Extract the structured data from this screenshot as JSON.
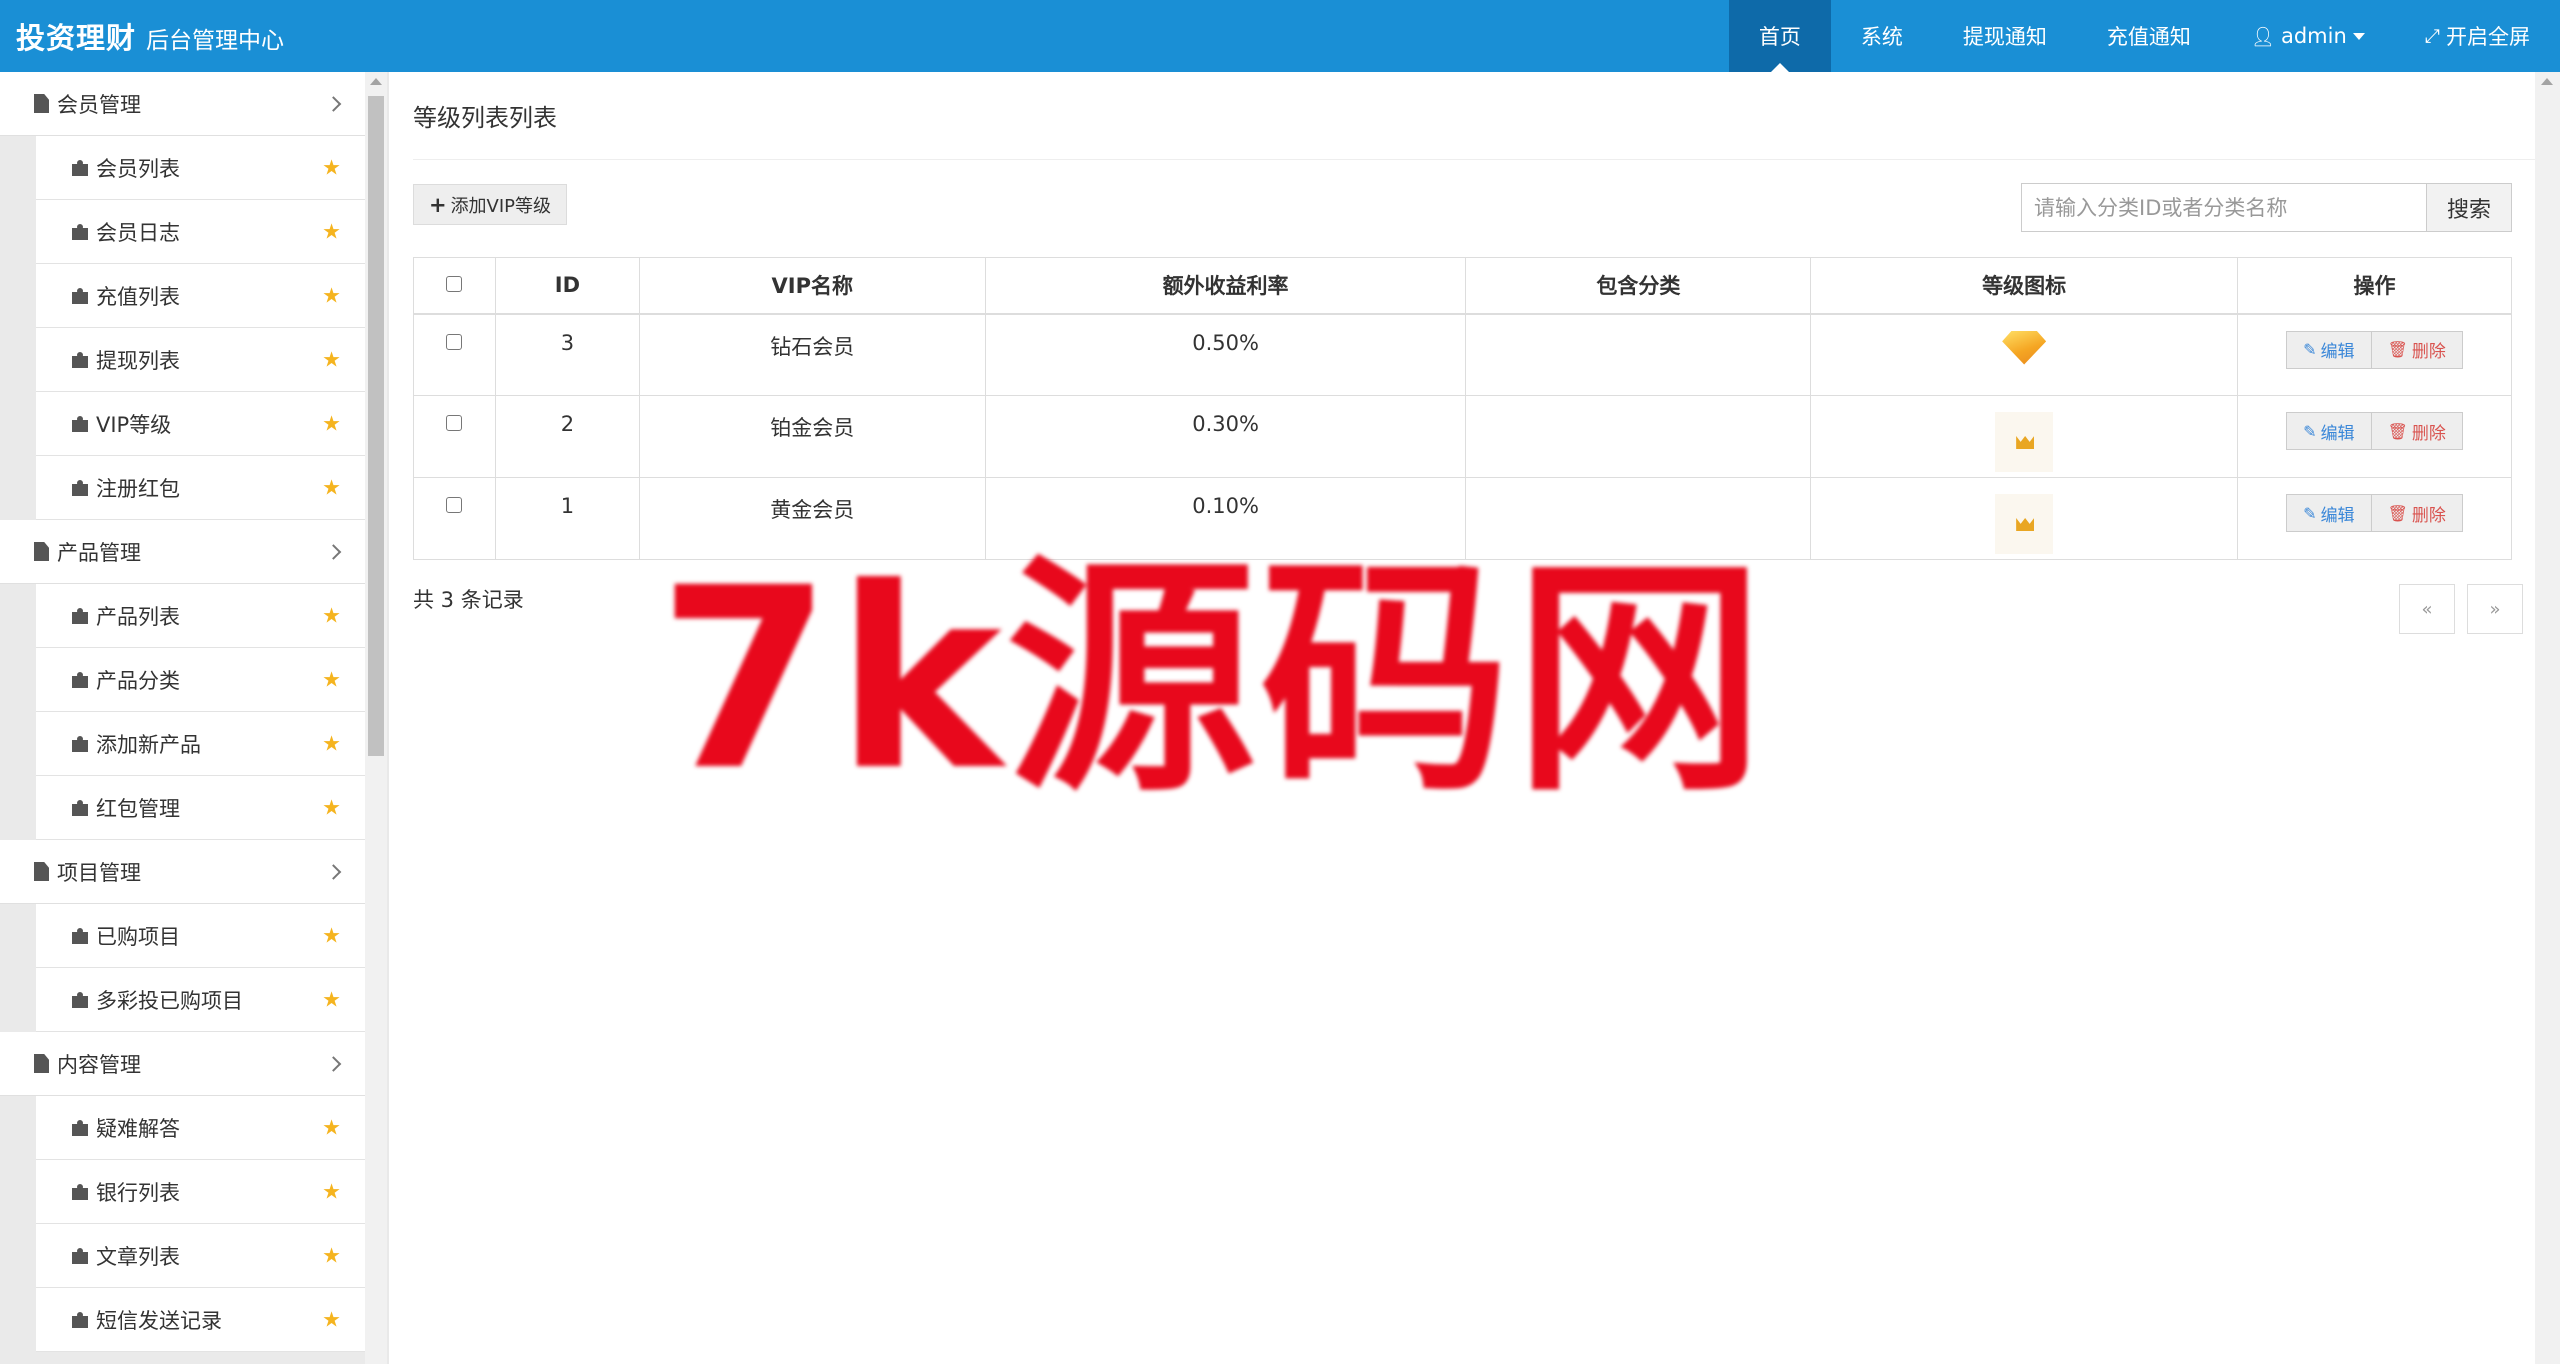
{
  "header": {
    "brand_main": "投资理财",
    "brand_sub": "后台管理中心",
    "nav": {
      "home": "首页",
      "system": "系统",
      "withdraw_notice": "提现通知",
      "recharge_notice": "充值通知",
      "user": "admin",
      "fullscreen": "开启全屏"
    }
  },
  "sidebar": {
    "groups": [
      {
        "title": "会员管理",
        "items": [
          "会员列表",
          "会员日志",
          "充值列表",
          "提现列表",
          "VIP等级",
          "注册红包"
        ]
      },
      {
        "title": "产品管理",
        "items": [
          "产品列表",
          "产品分类",
          "添加新产品",
          "红包管理"
        ]
      },
      {
        "title": "项目管理",
        "items": [
          "已购项目",
          "多彩投已购项目"
        ]
      },
      {
        "title": "内容管理",
        "items": [
          "疑难解答",
          "银行列表",
          "文章列表",
          "短信发送记录"
        ]
      }
    ]
  },
  "main": {
    "title": "等级列表列表",
    "add_button": "添加VIP等级",
    "search": {
      "placeholder": "请输入分类ID或者分类名称",
      "button": "搜索"
    },
    "table": {
      "headers": [
        "ID",
        "VIP名称",
        "额外收益利率",
        "包含分类",
        "等级图标",
        "操作"
      ],
      "rows": [
        {
          "id": "3",
          "name": "钻石会员",
          "rate": "0.50%",
          "category": "",
          "icon": "diamond-icon"
        },
        {
          "id": "2",
          "name": "铂金会员",
          "rate": "0.30%",
          "category": "",
          "icon": "crown-icon"
        },
        {
          "id": "1",
          "name": "黄金会员",
          "rate": "0.10%",
          "category": "",
          "icon": "crown-icon"
        }
      ],
      "edit_label": "编辑",
      "delete_label": "删除"
    },
    "record_count": "共 3 条记录",
    "pager": {
      "prev": "«",
      "next": "»"
    }
  },
  "watermark": "7k源码网",
  "colors": {
    "topbar": "#1a8fd5",
    "topbar_active": "#0e6aa9",
    "star": "#f5b41f",
    "edit": "#3a87d8",
    "delete": "#d9534f",
    "watermark": "#e8081c"
  }
}
